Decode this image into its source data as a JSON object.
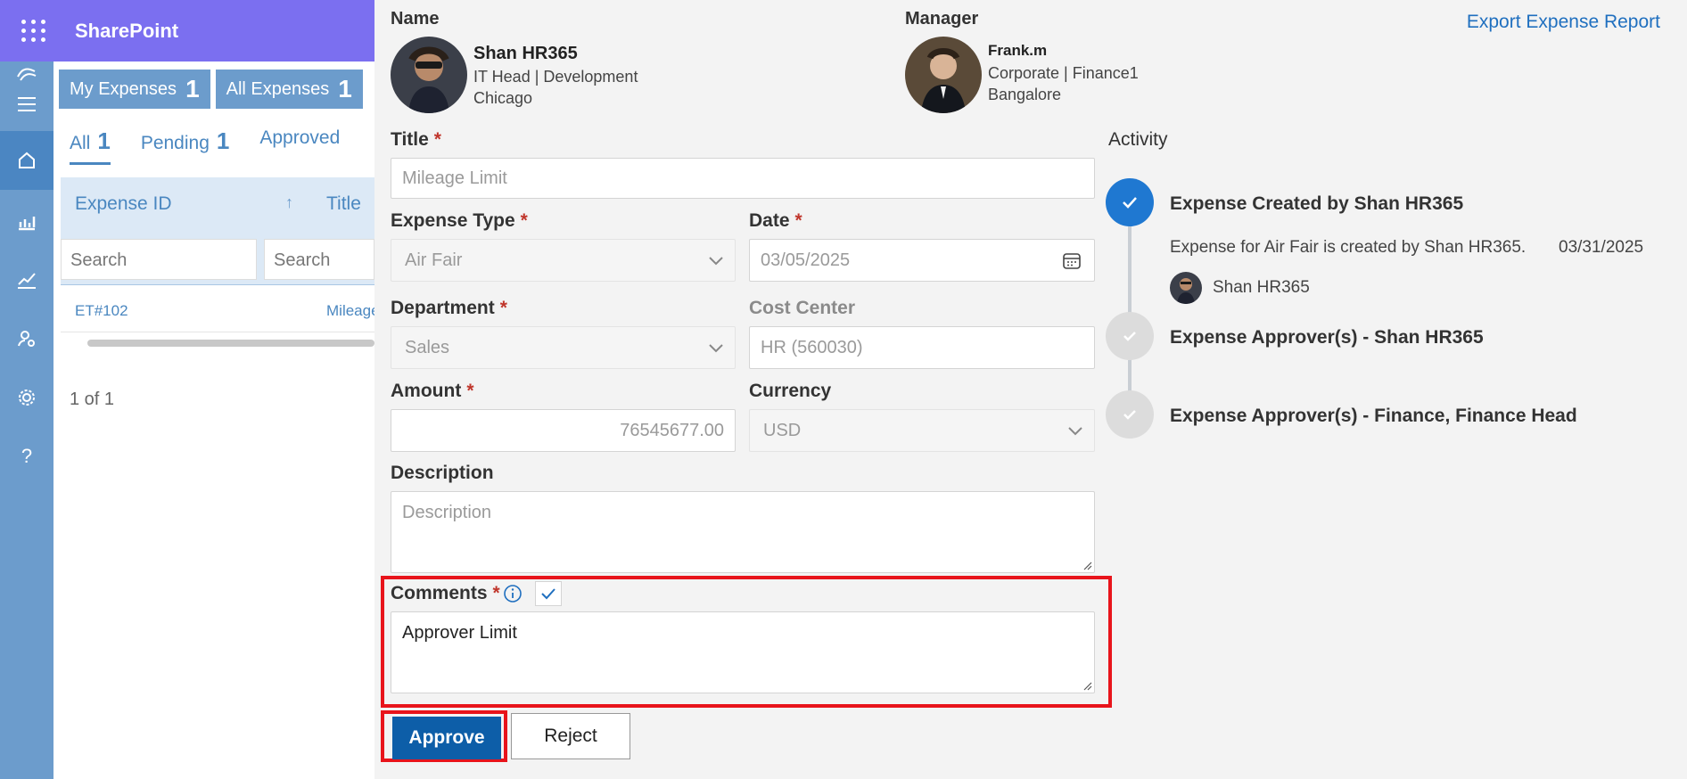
{
  "topbar": {
    "brand": "SharePoint"
  },
  "rail": {
    "icons": [
      "logo-icon",
      "hamburger-icon",
      "home-icon",
      "bar-chart-icon",
      "trend-icon",
      "user-settings-icon",
      "gear-icon",
      "help-icon"
    ],
    "help_glyph": "?"
  },
  "list": {
    "tabs": [
      {
        "label": "My Expenses",
        "count": "1"
      },
      {
        "label": "All Expenses",
        "count": "1"
      }
    ],
    "subtabs": [
      {
        "label": "All",
        "count": "1"
      },
      {
        "label": "Pending",
        "count": "1"
      },
      {
        "label": "Approved"
      }
    ],
    "columns": [
      "Expense ID",
      "Title"
    ],
    "sort_glyph": "↑",
    "search_placeholders": [
      "Search",
      "Search"
    ],
    "rows": [
      {
        "id": "ET#102",
        "title": "Mileage"
      }
    ],
    "pager": "1 of 1"
  },
  "panel": {
    "export_label": "Export Expense Report",
    "name_label": "Name",
    "manager_label": "Manager",
    "employee": {
      "name": "Shan HR365",
      "role": "IT Head | Development",
      "location": "Chicago"
    },
    "manager": {
      "name": "Frank.m",
      "role": "Corporate | Finance1",
      "location": "Bangalore"
    },
    "req": "*",
    "form": {
      "title_label": "Title",
      "title_placeholder": "Mileage Limit",
      "expense_type_label": "Expense Type",
      "expense_type_value": "Air Fair",
      "date_label": "Date",
      "date_value": "03/05/2025",
      "department_label": "Department",
      "department_value": "Sales",
      "cost_center_label": "Cost Center",
      "cost_center_value": "HR (560030)",
      "amount_label": "Amount",
      "amount_value": "76545677.00",
      "currency_label": "Currency",
      "currency_value": "USD",
      "description_label": "Description",
      "description_placeholder": "Description",
      "comments_label": "Comments",
      "comments_value": "Approver Limit"
    },
    "buttons": {
      "approve": "Approve",
      "reject": "Reject"
    }
  },
  "activity": {
    "title": "Activity",
    "items": [
      {
        "title": "Expense Created by Shan HR365",
        "text": "Expense for Air Fair is created by Shan HR365.",
        "date": "03/31/2025",
        "user": "Shan HR365"
      },
      {
        "title": "Expense Approver(s) - Shan HR365"
      },
      {
        "title": "Expense Approver(s) - Finance, Finance Head"
      }
    ]
  },
  "colors": {
    "accent": "#0d5ea8",
    "brand_bar": "#7b6ff0",
    "rail": "#6c9ccc",
    "required": "#c0362c",
    "highlight": "#e8141b"
  }
}
